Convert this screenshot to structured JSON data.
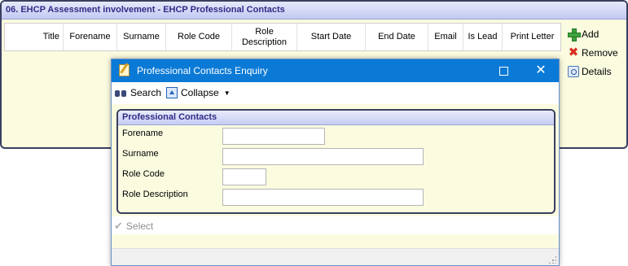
{
  "panel": {
    "title": "06. EHCP Assessment involvement - EHCP Professional Contacts",
    "columns": [
      "Title",
      "Forename",
      "Surname",
      "Role Code",
      "Role Description",
      "Start Date",
      "End Date",
      "Email",
      "Is Lead",
      "Print Letter"
    ],
    "actions": {
      "add": "Add",
      "remove": "Remove",
      "details": "Details"
    }
  },
  "dialog": {
    "title": "Professional Contacts Enquiry",
    "toolbar": {
      "search": "Search",
      "collapse": "Collapse"
    },
    "section_title": "Professional Contacts",
    "fields": {
      "forename": {
        "label": "Forename",
        "value": ""
      },
      "surname": {
        "label": "Surname",
        "value": ""
      },
      "role_code": {
        "label": "Role Code",
        "value": ""
      },
      "role_description": {
        "label": "Role Description",
        "value": ""
      }
    },
    "select_label": "Select"
  },
  "icons": {
    "add": "plus-icon",
    "remove": "remove-x-icon",
    "details": "details-icon",
    "search": "binoculars-icon",
    "collapse": "collapse-icon",
    "select": "checkmark-icon"
  },
  "colors": {
    "panel_bg": "#fbfbe0",
    "title_text": "#332a86",
    "titlebar": "#0b7ad6",
    "border": "#3a3f5e"
  }
}
